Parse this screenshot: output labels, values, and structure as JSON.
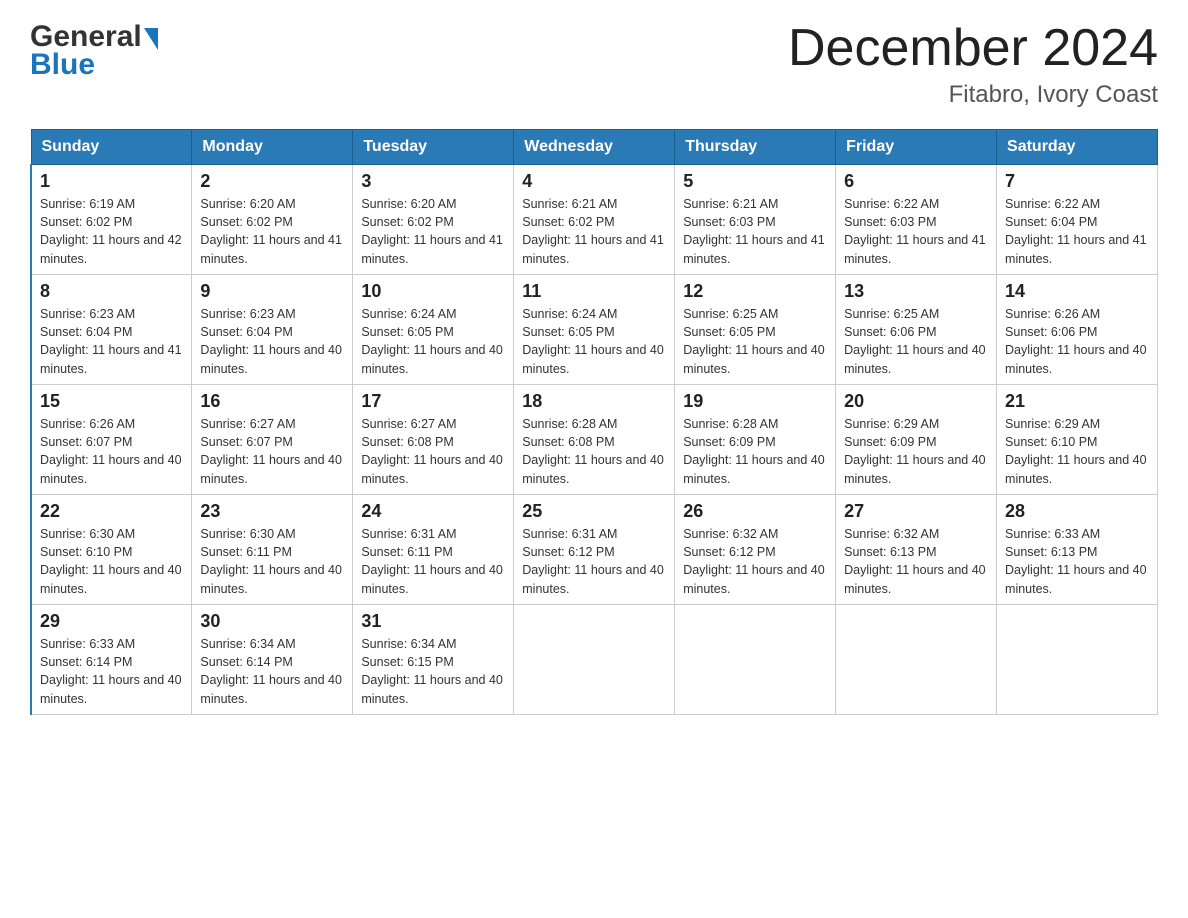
{
  "header": {
    "logo_general": "General",
    "logo_blue": "Blue",
    "month_title": "December 2024",
    "location": "Fitabro, Ivory Coast"
  },
  "days_of_week": [
    "Sunday",
    "Monday",
    "Tuesday",
    "Wednesday",
    "Thursday",
    "Friday",
    "Saturday"
  ],
  "weeks": [
    [
      {
        "day": "1",
        "sunrise": "Sunrise: 6:19 AM",
        "sunset": "Sunset: 6:02 PM",
        "daylight": "Daylight: 11 hours and 42 minutes."
      },
      {
        "day": "2",
        "sunrise": "Sunrise: 6:20 AM",
        "sunset": "Sunset: 6:02 PM",
        "daylight": "Daylight: 11 hours and 41 minutes."
      },
      {
        "day": "3",
        "sunrise": "Sunrise: 6:20 AM",
        "sunset": "Sunset: 6:02 PM",
        "daylight": "Daylight: 11 hours and 41 minutes."
      },
      {
        "day": "4",
        "sunrise": "Sunrise: 6:21 AM",
        "sunset": "Sunset: 6:02 PM",
        "daylight": "Daylight: 11 hours and 41 minutes."
      },
      {
        "day": "5",
        "sunrise": "Sunrise: 6:21 AM",
        "sunset": "Sunset: 6:03 PM",
        "daylight": "Daylight: 11 hours and 41 minutes."
      },
      {
        "day": "6",
        "sunrise": "Sunrise: 6:22 AM",
        "sunset": "Sunset: 6:03 PM",
        "daylight": "Daylight: 11 hours and 41 minutes."
      },
      {
        "day": "7",
        "sunrise": "Sunrise: 6:22 AM",
        "sunset": "Sunset: 6:04 PM",
        "daylight": "Daylight: 11 hours and 41 minutes."
      }
    ],
    [
      {
        "day": "8",
        "sunrise": "Sunrise: 6:23 AM",
        "sunset": "Sunset: 6:04 PM",
        "daylight": "Daylight: 11 hours and 41 minutes."
      },
      {
        "day": "9",
        "sunrise": "Sunrise: 6:23 AM",
        "sunset": "Sunset: 6:04 PM",
        "daylight": "Daylight: 11 hours and 40 minutes."
      },
      {
        "day": "10",
        "sunrise": "Sunrise: 6:24 AM",
        "sunset": "Sunset: 6:05 PM",
        "daylight": "Daylight: 11 hours and 40 minutes."
      },
      {
        "day": "11",
        "sunrise": "Sunrise: 6:24 AM",
        "sunset": "Sunset: 6:05 PM",
        "daylight": "Daylight: 11 hours and 40 minutes."
      },
      {
        "day": "12",
        "sunrise": "Sunrise: 6:25 AM",
        "sunset": "Sunset: 6:05 PM",
        "daylight": "Daylight: 11 hours and 40 minutes."
      },
      {
        "day": "13",
        "sunrise": "Sunrise: 6:25 AM",
        "sunset": "Sunset: 6:06 PM",
        "daylight": "Daylight: 11 hours and 40 minutes."
      },
      {
        "day": "14",
        "sunrise": "Sunrise: 6:26 AM",
        "sunset": "Sunset: 6:06 PM",
        "daylight": "Daylight: 11 hours and 40 minutes."
      }
    ],
    [
      {
        "day": "15",
        "sunrise": "Sunrise: 6:26 AM",
        "sunset": "Sunset: 6:07 PM",
        "daylight": "Daylight: 11 hours and 40 minutes."
      },
      {
        "day": "16",
        "sunrise": "Sunrise: 6:27 AM",
        "sunset": "Sunset: 6:07 PM",
        "daylight": "Daylight: 11 hours and 40 minutes."
      },
      {
        "day": "17",
        "sunrise": "Sunrise: 6:27 AM",
        "sunset": "Sunset: 6:08 PM",
        "daylight": "Daylight: 11 hours and 40 minutes."
      },
      {
        "day": "18",
        "sunrise": "Sunrise: 6:28 AM",
        "sunset": "Sunset: 6:08 PM",
        "daylight": "Daylight: 11 hours and 40 minutes."
      },
      {
        "day": "19",
        "sunrise": "Sunrise: 6:28 AM",
        "sunset": "Sunset: 6:09 PM",
        "daylight": "Daylight: 11 hours and 40 minutes."
      },
      {
        "day": "20",
        "sunrise": "Sunrise: 6:29 AM",
        "sunset": "Sunset: 6:09 PM",
        "daylight": "Daylight: 11 hours and 40 minutes."
      },
      {
        "day": "21",
        "sunrise": "Sunrise: 6:29 AM",
        "sunset": "Sunset: 6:10 PM",
        "daylight": "Daylight: 11 hours and 40 minutes."
      }
    ],
    [
      {
        "day": "22",
        "sunrise": "Sunrise: 6:30 AM",
        "sunset": "Sunset: 6:10 PM",
        "daylight": "Daylight: 11 hours and 40 minutes."
      },
      {
        "day": "23",
        "sunrise": "Sunrise: 6:30 AM",
        "sunset": "Sunset: 6:11 PM",
        "daylight": "Daylight: 11 hours and 40 minutes."
      },
      {
        "day": "24",
        "sunrise": "Sunrise: 6:31 AM",
        "sunset": "Sunset: 6:11 PM",
        "daylight": "Daylight: 11 hours and 40 minutes."
      },
      {
        "day": "25",
        "sunrise": "Sunrise: 6:31 AM",
        "sunset": "Sunset: 6:12 PM",
        "daylight": "Daylight: 11 hours and 40 minutes."
      },
      {
        "day": "26",
        "sunrise": "Sunrise: 6:32 AM",
        "sunset": "Sunset: 6:12 PM",
        "daylight": "Daylight: 11 hours and 40 minutes."
      },
      {
        "day": "27",
        "sunrise": "Sunrise: 6:32 AM",
        "sunset": "Sunset: 6:13 PM",
        "daylight": "Daylight: 11 hours and 40 minutes."
      },
      {
        "day": "28",
        "sunrise": "Sunrise: 6:33 AM",
        "sunset": "Sunset: 6:13 PM",
        "daylight": "Daylight: 11 hours and 40 minutes."
      }
    ],
    [
      {
        "day": "29",
        "sunrise": "Sunrise: 6:33 AM",
        "sunset": "Sunset: 6:14 PM",
        "daylight": "Daylight: 11 hours and 40 minutes."
      },
      {
        "day": "30",
        "sunrise": "Sunrise: 6:34 AM",
        "sunset": "Sunset: 6:14 PM",
        "daylight": "Daylight: 11 hours and 40 minutes."
      },
      {
        "day": "31",
        "sunrise": "Sunrise: 6:34 AM",
        "sunset": "Sunset: 6:15 PM",
        "daylight": "Daylight: 11 hours and 40 minutes."
      },
      null,
      null,
      null,
      null
    ]
  ]
}
